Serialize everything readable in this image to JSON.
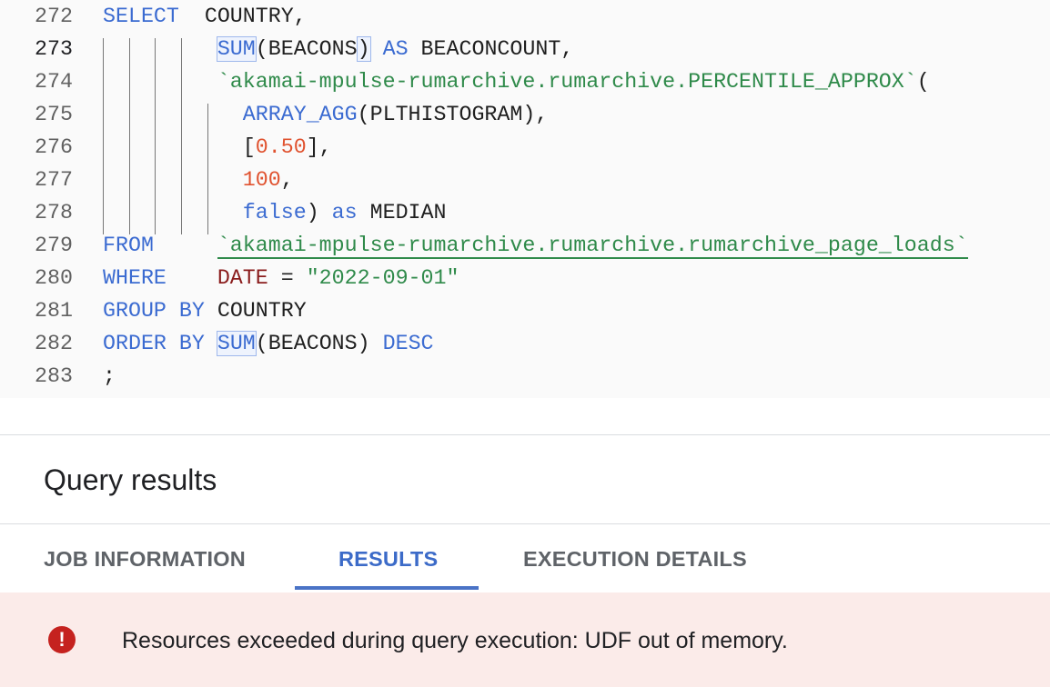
{
  "editor": {
    "current_line": "273",
    "lines": [
      {
        "num": "272",
        "tokens": [
          {
            "t": "SELECT",
            "c": "kw"
          },
          {
            "t": "  COUNTRY,"
          }
        ]
      },
      {
        "num": "273",
        "tokens": [
          {
            "t": "         "
          },
          {
            "t": "SUM",
            "c": "kw hl"
          },
          {
            "t": "(BEACONS"
          },
          {
            "t": ")",
            "c": "hl"
          },
          {
            "t": " "
          },
          {
            "t": "AS",
            "c": "kw"
          },
          {
            "t": " BEACONCOUNT,"
          }
        ]
      },
      {
        "num": "274",
        "tokens": [
          {
            "t": "         "
          },
          {
            "t": "`akamai-mpulse-rumarchive.rumarchive.PERCENTILE_APPROX`",
            "c": "str"
          },
          {
            "t": "("
          }
        ]
      },
      {
        "num": "275",
        "tokens": [
          {
            "t": "           "
          },
          {
            "t": "ARRAY_AGG",
            "c": "kw"
          },
          {
            "t": "(PLTHISTOGRAM),"
          }
        ]
      },
      {
        "num": "276",
        "tokens": [
          {
            "t": "           ["
          },
          {
            "t": "0.50",
            "c": "num"
          },
          {
            "t": "],"
          }
        ]
      },
      {
        "num": "277",
        "tokens": [
          {
            "t": "           "
          },
          {
            "t": "100",
            "c": "num"
          },
          {
            "t": ","
          }
        ]
      },
      {
        "num": "278",
        "tokens": [
          {
            "t": "           "
          },
          {
            "t": "false",
            "c": "kw"
          },
          {
            "t": ") "
          },
          {
            "t": "as",
            "c": "kw"
          },
          {
            "t": " MEDIAN"
          }
        ]
      },
      {
        "num": "279",
        "tokens": [
          {
            "t": "FROM",
            "c": "kw"
          },
          {
            "t": "     "
          },
          {
            "t": "`akamai-mpulse-rumarchive.rumarchive.rumarchive_page_loads`",
            "c": "str ul"
          }
        ]
      },
      {
        "num": "280",
        "tokens": [
          {
            "t": "WHERE",
            "c": "kw"
          },
          {
            "t": "    "
          },
          {
            "t": "DATE",
            "c": "col"
          },
          {
            "t": " = "
          },
          {
            "t": "\"2022-09-01\"",
            "c": "str"
          }
        ]
      },
      {
        "num": "281",
        "tokens": [
          {
            "t": "GROUP",
            "c": "kw"
          },
          {
            "t": " "
          },
          {
            "t": "BY",
            "c": "kw"
          },
          {
            "t": " COUNTRY"
          }
        ]
      },
      {
        "num": "282",
        "tokens": [
          {
            "t": "ORDER",
            "c": "kw"
          },
          {
            "t": " "
          },
          {
            "t": "BY",
            "c": "kw"
          },
          {
            "t": " "
          },
          {
            "t": "SUM",
            "c": "kw hl"
          },
          {
            "t": "(BEACONS) "
          },
          {
            "t": "DESC",
            "c": "kw"
          }
        ]
      },
      {
        "num": "283",
        "tokens": [
          {
            "t": ";"
          }
        ]
      }
    ]
  },
  "results": {
    "title": "Query results",
    "tabs": [
      {
        "label": "JOB INFORMATION",
        "active": false
      },
      {
        "label": "RESULTS",
        "active": true
      },
      {
        "label": "EXECUTION DETAILS",
        "active": false
      }
    ]
  },
  "error": {
    "icon": "error-icon",
    "icon_glyph": "!",
    "message": "Resources exceeded during query execution: UDF out of memory.",
    "color": "#c5221f",
    "background": "#fbebe9"
  }
}
